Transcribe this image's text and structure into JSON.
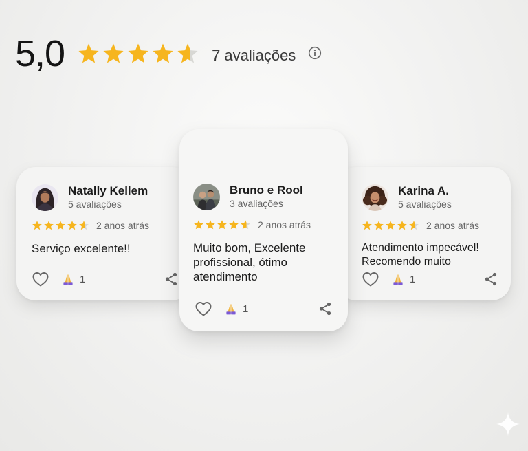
{
  "summary": {
    "score": "5,0",
    "stars": 4.6,
    "count_label": "7 avaliações",
    "star_color": "#F6B51E",
    "star_empty_color": "#D8D8D4"
  },
  "reviews": [
    {
      "name": "Natally Kellem",
      "review_count": "5 avaliações",
      "stars": 4.6,
      "time": "2 anos atrás",
      "text": "Serviço excelente!!",
      "reactions": "1"
    },
    {
      "name": "Bruno e Rool",
      "review_count": "3 avaliações",
      "stars": 4.6,
      "time": "2 anos atrás",
      "text": "Muito bom, Excelente profissional, ótimo atendimento",
      "reactions": "1"
    },
    {
      "name": "Karina A.",
      "review_count": "5 avaliações",
      "stars": 4.6,
      "time": "2 anos atrás",
      "text": "Atendimento impecável! Recomendo muito",
      "reactions": "1"
    }
  ],
  "icons": {
    "info": "info-icon",
    "like": "heart-icon",
    "reaction": "praying-hands-icon",
    "share": "share-icon",
    "brand": "sparkle-icon"
  }
}
